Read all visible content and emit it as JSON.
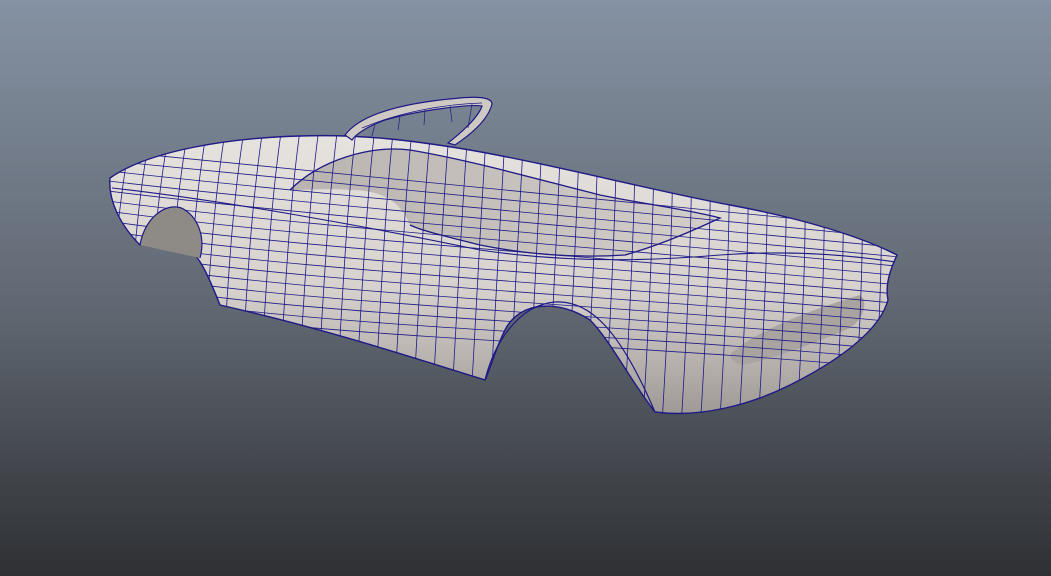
{
  "viewport": {
    "background_top": "#8592a3",
    "background_mid": "#5f6670",
    "background_bottom": "#2e3033"
  },
  "model": {
    "surface_color": "#d7d2cd",
    "surface_shadow": "#9f9a96",
    "wire_color": "#1e1a86",
    "interior_color": "#c4bfba",
    "windshield_frame": "#cfc9c4"
  }
}
